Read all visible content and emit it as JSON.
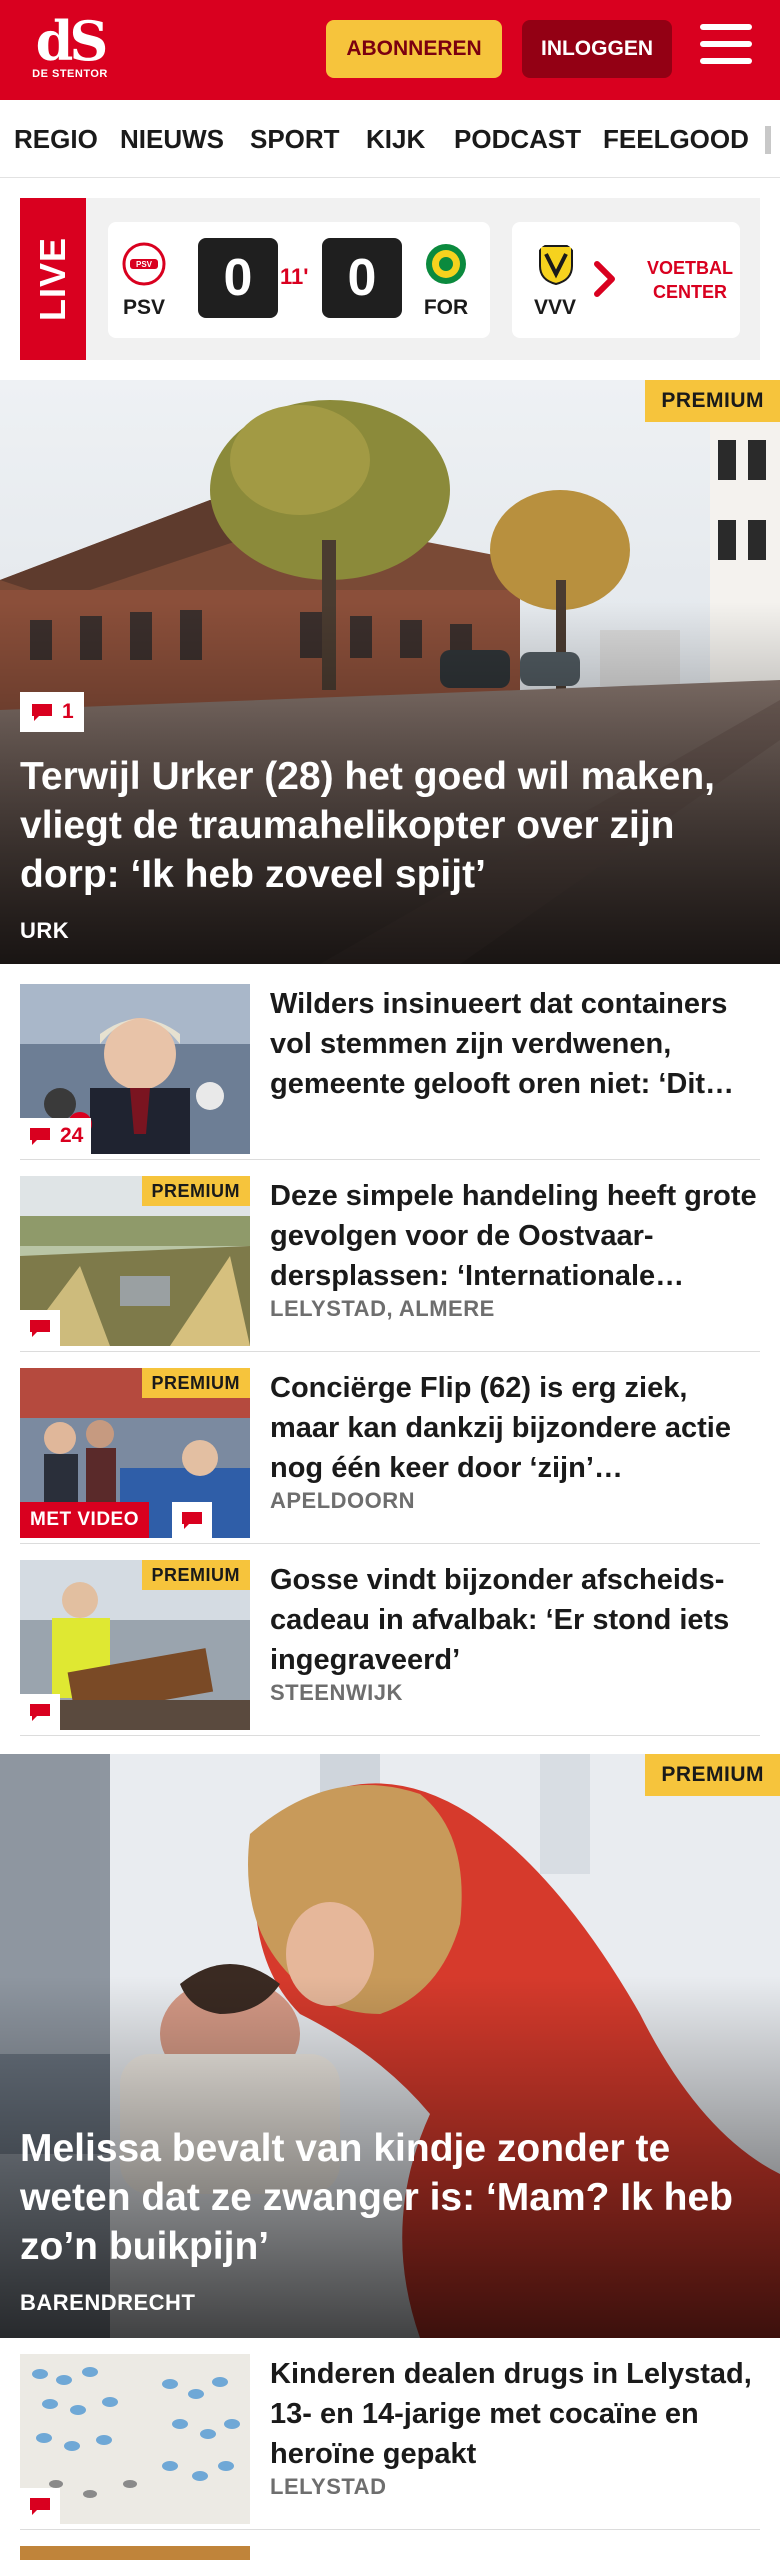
{
  "header": {
    "logo_mark": "dS",
    "logo_sub": "DE STENTOR",
    "subscribe_label": "ABONNEREN",
    "login_label": "INLOGGEN",
    "accent_color": "#d9001f",
    "highlight_color": "#f6c43c"
  },
  "nav": {
    "items": [
      "REGIO",
      "NIEUWS",
      "SPORT",
      "KIJK",
      "PODCAST",
      "FEELGOOD"
    ]
  },
  "live": {
    "badge": "LIVE",
    "match": {
      "home": "PSV",
      "away": "FOR",
      "home_score": "0",
      "away_score": "0",
      "minute": "11'"
    },
    "next_team": "VVV",
    "voetbal_center": "VOETBAL CENTER"
  },
  "hero1": {
    "premium": "PREMIUM",
    "comments": "1",
    "title": "Terwijl Urker (28) het goed wil maken, vliegt de traumahelikopter over zijn dorp: ‘Ik heb zoveel spijt’",
    "location": "URK"
  },
  "articles": [
    {
      "title": "Wilders insinueert dat containers vol stemmen zijn verdwenen, gemeente gelooft oren niet: ‘Dit…",
      "comments": "24",
      "location": ""
    },
    {
      "title": "Deze simpele handeling heeft grote gevolgen voor de Oostvaar­dersplassen: ‘Internationale…",
      "premium": "PREMIUM",
      "location": "LELYSTAD, ALMERE"
    },
    {
      "title": "Conciërge Flip (62) is erg ziek, maar kan dankzij bijzondere actie nog één keer door ‘zijn’…",
      "premium": "PREMIUM",
      "video": "MET VIDEO",
      "location": "APELDOORN"
    },
    {
      "title": "Gosse vindt bijzonder afscheids­cadeau in afvalbak: ‘Er stond iets ingegraveerd’",
      "premium": "PREMIUM",
      "location": "STEENWIJK"
    }
  ],
  "hero2": {
    "premium": "PREMIUM",
    "title": "Melissa bevalt van kindje zonder te weten dat ze zwanger is: ‘Mam? Ik heb zo’n buikpijn’",
    "location": "BARENDRECHT"
  },
  "articles2": [
    {
      "title": "Kinderen dealen drugs in Lelystad, 13- en 14-jarige met cocaïne en heroïne gepakt",
      "location": "LELYSTAD"
    }
  ]
}
